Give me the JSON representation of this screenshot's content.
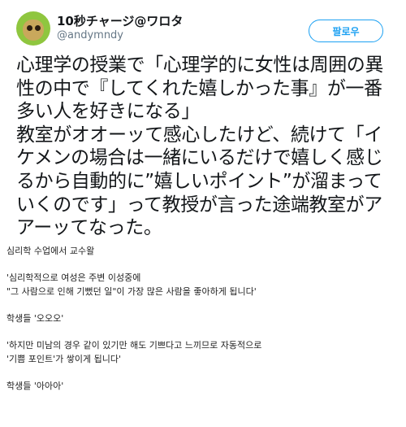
{
  "tweet": {
    "display_name": "10秒チャージ@ワロタ",
    "handle": "@andymndy",
    "follow_label": "팔로우",
    "text_lines": [
      "心理学の授業で「心理学的に女性は周囲の異",
      "性の中で『してくれた嬉しかった事』が一番",
      "多い人を好きになる」",
      "教室がオオーッて感心したけど、続けて「イ",
      "ケメンの場合は一緒にいるだけで嬉しく感じ",
      "るから自動的に”嬉しいポイント”が溜まって",
      "いくのです」って教授が言った途端教室がア",
      "アーッてなった。"
    ]
  },
  "translation": {
    "intro": "심리학 수업에서 교수왈",
    "quote1_line1": "'심리학적으로 여성은 주변 이성중에",
    "quote1_line2": "\"그 사람으로 인해 기뻤던 일\"이 가장 많은 사람을 좋아하게 됩니다'",
    "students1": "학생들 '오오오'",
    "quote2_line1": "'하지만 미남의 경우 같이 있기만 해도 기쁘다고 느끼므로 자동적으로",
    "quote2_line2": "'기쁨 포인트'가 쌓이게 됩니다'",
    "students2": "학생들 '아아아'"
  },
  "colors": {
    "accent": "#1da1f2",
    "text": "#14171a",
    "muted": "#657786",
    "avatar_bg": "#8fc63f"
  }
}
